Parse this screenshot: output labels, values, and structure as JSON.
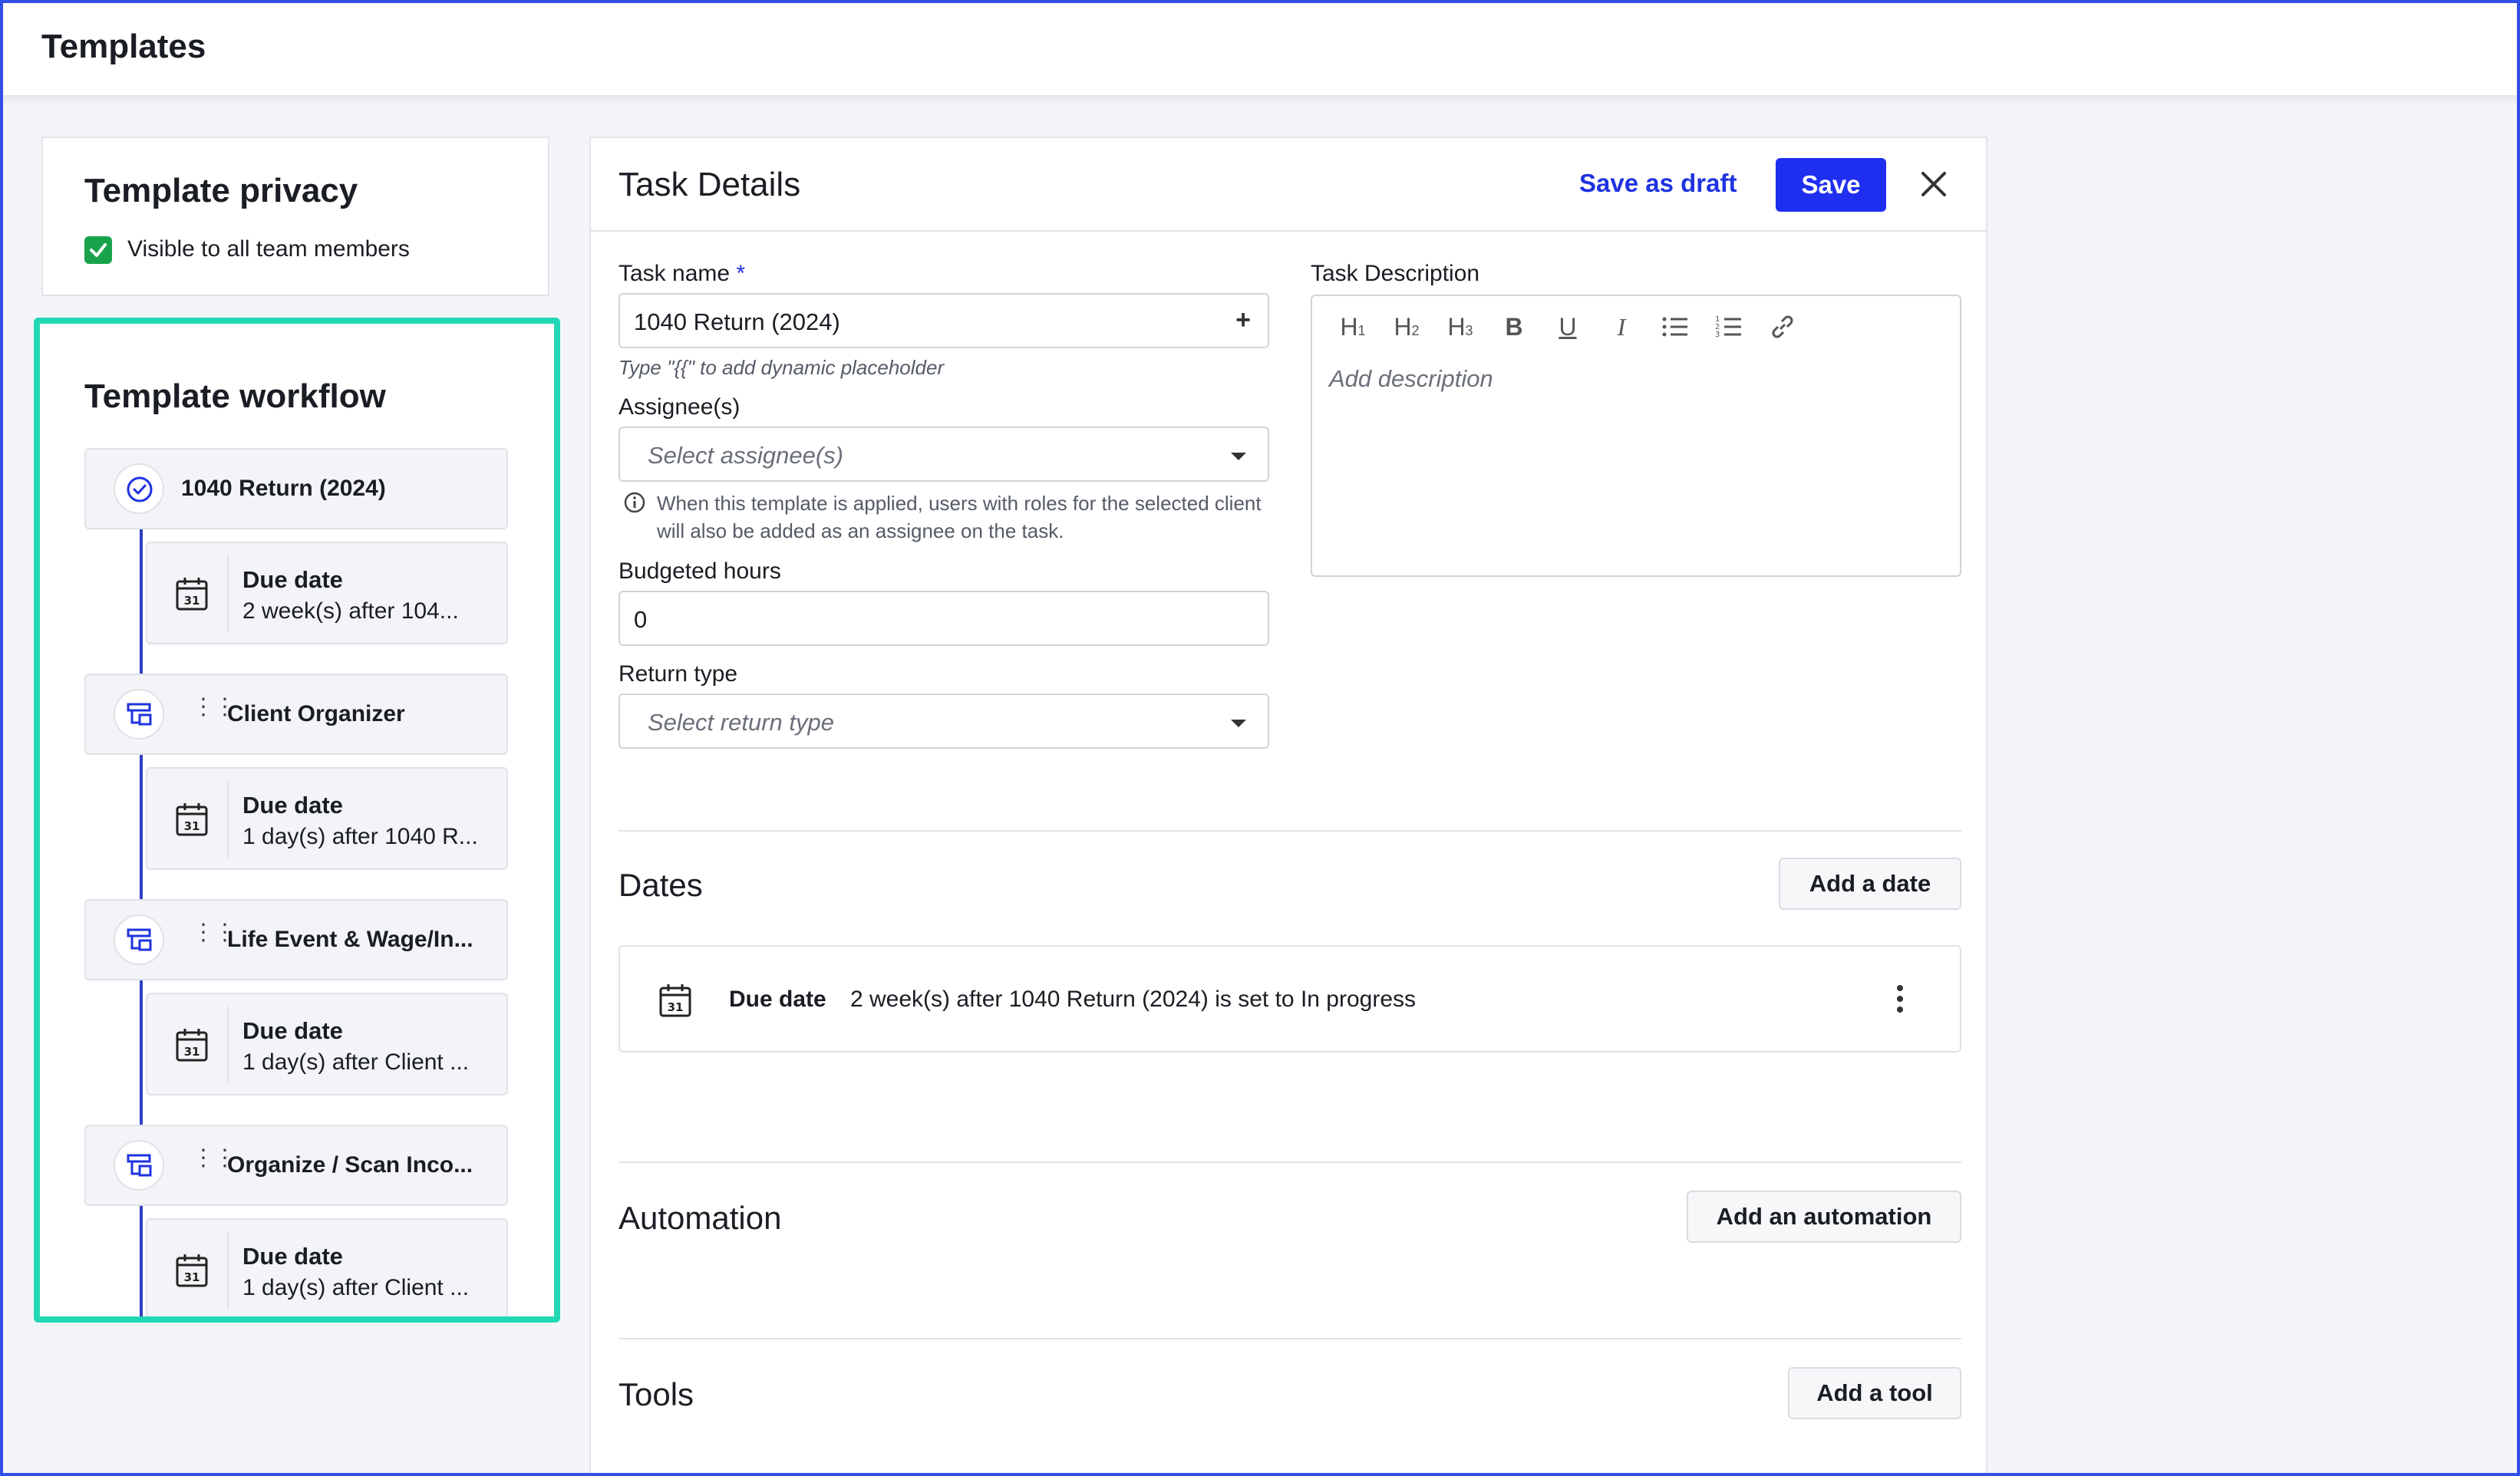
{
  "header": {
    "title": "Templates"
  },
  "privacy": {
    "title": "Template privacy",
    "checkbox_label": "Visible to all team members",
    "checked": true
  },
  "workflow": {
    "title": "Template workflow",
    "steps": [
      {
        "title": "1040 Return (2024)",
        "icon": "check-circle-icon",
        "due_label": "Due date",
        "due_text": "2 week(s) after 104..."
      },
      {
        "title": "Client Organizer",
        "icon": "organizer-icon",
        "due_label": "Due date",
        "due_text": "1 day(s) after 1040 R..."
      },
      {
        "title": "Life Event & Wage/In...",
        "icon": "organizer-icon",
        "due_label": "Due date",
        "due_text": "1 day(s) after Client ..."
      },
      {
        "title": "Organize / Scan Inco...",
        "icon": "organizer-icon",
        "due_label": "Due date",
        "due_text": "1 day(s) after Client ..."
      }
    ]
  },
  "task": {
    "title": "Task Details",
    "save_draft_label": "Save as draft",
    "save_label": "Save",
    "name_label": "Task name",
    "name_required": "*",
    "name_value": "1040 Return (2024)",
    "name_hint": "Type \"{{\" to add dynamic placeholder",
    "assignee_label": "Assignee(s)",
    "assignee_placeholder": "Select assignee(s)",
    "assignee_info": "When this template is applied, users with roles for the selected client will also be added as an assignee on the task.",
    "budget_label": "Budgeted hours",
    "budget_value": "0",
    "return_label": "Return type",
    "return_placeholder": "Select return type",
    "desc_label": "Task Description",
    "desc_placeholder": "Add description",
    "toolbar": [
      "H1",
      "H2",
      "H3",
      "bold",
      "underline",
      "italic",
      "bullet-list",
      "numbered-list",
      "link"
    ]
  },
  "dates": {
    "title": "Dates",
    "add_label": "Add a date",
    "row_label": "Due date",
    "row_text": "2 week(s) after 1040 Return (2024) is set to In progress"
  },
  "automation": {
    "title": "Automation",
    "add_label": "Add an automation"
  },
  "tools": {
    "title": "Tools",
    "add_label": "Add a tool"
  },
  "colors": {
    "accent": "#1f2ff0",
    "highlight": "#22d7b4",
    "check": "#18a34a"
  }
}
